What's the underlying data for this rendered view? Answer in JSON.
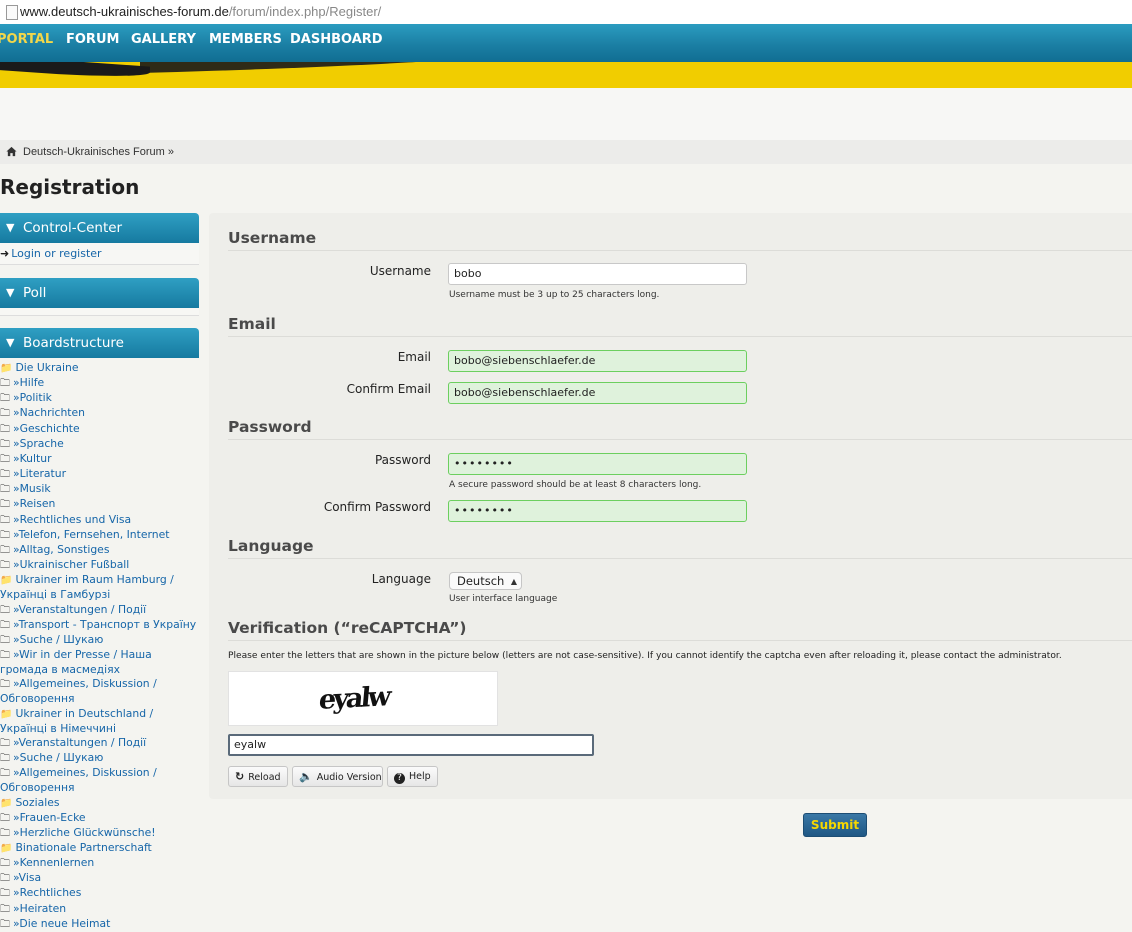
{
  "browser": {
    "url_domain": "www.deutsch-ukrainisches-forum.de",
    "url_path": "/forum/index.php/Register/"
  },
  "nav": {
    "items": [
      {
        "label": "PORTAL"
      },
      {
        "label": "FORUM"
      },
      {
        "label": "GALLERY"
      },
      {
        "label": "MEMBERS"
      },
      {
        "label": "DASHBOARD"
      }
    ]
  },
  "breadcrumb": {
    "text": "Deutsch-Ukrainisches Forum »"
  },
  "page_title": "Registration",
  "sidebar": {
    "control_center": {
      "title": "Control-Center",
      "login_link": "Login or register"
    },
    "poll": {
      "title": "Poll"
    },
    "board": {
      "title": "Boardstructure",
      "items": [
        {
          "label": "Die Ukraine"
        },
        {
          "label": "»Hilfe"
        },
        {
          "label": "»Politik"
        },
        {
          "label": "»Nachrichten"
        },
        {
          "label": "»Geschichte"
        },
        {
          "label": "»Sprache"
        },
        {
          "label": "»Kultur"
        },
        {
          "label": "»Literatur"
        },
        {
          "label": "»Musik"
        },
        {
          "label": "»Reisen"
        },
        {
          "label": "»Rechtliches und Visa"
        },
        {
          "label": "»Telefon, Fernsehen, Internet"
        },
        {
          "label": "»Alltag, Sonstiges"
        },
        {
          "label": "»Ukrainischer Fußball"
        },
        {
          "label": "Ukrainer im Raum Hamburg / Українці в Гамбурзі"
        },
        {
          "label": "»Veranstaltungen / Події"
        },
        {
          "label": "»Transport - Транспорт в Україну"
        },
        {
          "label": "»Suche / Шукаю"
        },
        {
          "label": "»Wir in der Presse / Наша громада в масмедіях"
        },
        {
          "label": "»Allgemeines, Diskussion / Обговорення"
        },
        {
          "label": "Ukrainer in Deutschland / Українці в Німеччині"
        },
        {
          "label": "»Veranstaltungen / Події"
        },
        {
          "label": "»Suche / Шукаю"
        },
        {
          "label": "»Allgemeines, Diskussion / Обговорення"
        },
        {
          "label": "Soziales"
        },
        {
          "label": "»Frauen-Ecke"
        },
        {
          "label": "»Herzliche Glückwünsche!"
        },
        {
          "label": "Binationale Partnerschaft"
        },
        {
          "label": "»Kennenlernen"
        },
        {
          "label": "»Visa"
        },
        {
          "label": "»Rechtliches"
        },
        {
          "label": "»Heiraten"
        },
        {
          "label": "»Die neue Heimat"
        }
      ]
    }
  },
  "form": {
    "username_section": "Username",
    "username_label": "Username",
    "username_value": "bobo",
    "username_help": "Username must be 3 up to 25 characters long.",
    "email_section": "Email",
    "email_label": "Email",
    "email_value": "bobo@siebenschlaefer.de",
    "confirm_email_label": "Confirm Email",
    "confirm_email_value": "bobo@siebenschlaefer.de",
    "password_section": "Password",
    "password_label": "Password",
    "password_value": "••••••••",
    "password_help": "A secure password should be at least 8 characters long.",
    "confirm_password_label": "Confirm Password",
    "confirm_password_value": "••••••••",
    "language_section": "Language",
    "language_label": "Language",
    "language_value": "Deutsch",
    "language_help": "User interface language",
    "verification_section": "Verification (“reCAPTCHA”)",
    "captcha_note": "Please enter the letters that are shown in the picture below (letters are not case-sensitive). If you cannot identify the captcha even after reloading it, please contact the administrator.",
    "captcha_image_text": "eyalw",
    "captcha_input_value": "eyalw",
    "reload_label": "Reload",
    "audio_label": "Audio Version",
    "help_label": "Help",
    "submit_label": "Submit"
  }
}
